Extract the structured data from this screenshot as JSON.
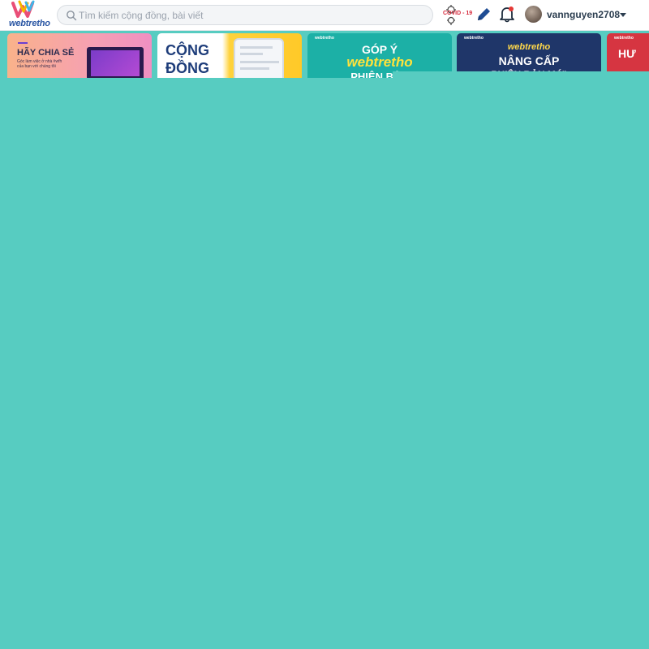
{
  "app": {
    "logo_text": "webtretho"
  },
  "search": {
    "placeholder": "Tìm kiếm cộng đồng, bài viết"
  },
  "header": {
    "covid_label": "COVID - 19",
    "username": "vannguyen2708"
  },
  "banners": [
    {
      "title": "HÃY CHIA SẺ",
      "subtitle": "Góc làm việc ở nhà #wfh\ncủa bạn với chúng tôi",
      "color": "#f6a0b3"
    },
    {
      "title": "CỘNG\nĐỒNG",
      "color": "#ffc928"
    },
    {
      "title": "GÓP Ý",
      "brand": "webtretho",
      "more": "PHIÊN BẢN",
      "color": "#1cb0a6"
    },
    {
      "brand": "webtretho",
      "title": "NÂNG CẤP",
      "more": "PHIÊN BẢN MỚI",
      "color": "#1f3669"
    },
    {
      "title": "HƯ",
      "color": "#d63541"
    }
  ],
  "colors": {
    "overlay": "#57ccc1",
    "brand_blue": "#2a56a3"
  }
}
